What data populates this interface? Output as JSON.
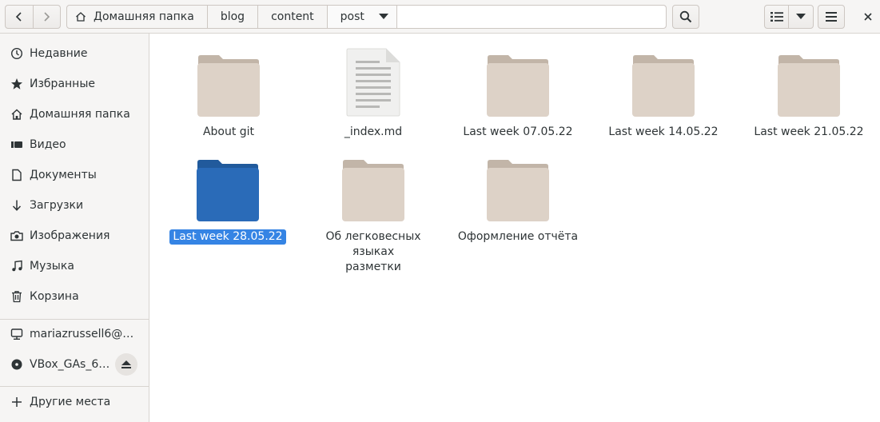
{
  "pathbar": {
    "home_label": "Домашняя папка",
    "crumbs": [
      "blog",
      "content"
    ],
    "current": "post"
  },
  "sidebar": {
    "items": [
      {
        "label": "Недавние",
        "icon": "clock-icon"
      },
      {
        "label": "Избранные",
        "icon": "star-icon"
      },
      {
        "label": "Домашняя папка",
        "icon": "home-icon"
      },
      {
        "label": "Видео",
        "icon": "video-icon"
      },
      {
        "label": "Документы",
        "icon": "document-icon"
      },
      {
        "label": "Загрузки",
        "icon": "download-icon"
      },
      {
        "label": "Изображения",
        "icon": "camera-icon"
      },
      {
        "label": "Музыка",
        "icon": "music-icon"
      },
      {
        "label": "Корзина",
        "icon": "trash-icon"
      }
    ],
    "network_label": "mariazrussell6@…",
    "drive_label": "VBox_GAs_6.…",
    "other_label": "Другие места"
  },
  "files": [
    {
      "name": "About git",
      "type": "folder"
    },
    {
      "name": "_index.md",
      "type": "document"
    },
    {
      "name": "Last week 07.05.22",
      "type": "folder"
    },
    {
      "name": "Last week 14.05.22",
      "type": "folder"
    },
    {
      "name": "Last week 21.05.22",
      "type": "folder"
    },
    {
      "name": "Last week 28.05.22",
      "type": "folder",
      "selected": true
    },
    {
      "name": "Об легковесных языках разметки",
      "type": "folder"
    },
    {
      "name": "Оформление отчёта",
      "type": "folder"
    }
  ],
  "colors": {
    "folder": "#ddd2c7",
    "folder_tab": "#c2b5a8",
    "selected_folder": "#2a6bb8",
    "selected_tab": "#215a9c",
    "accent": "#3584e4"
  }
}
